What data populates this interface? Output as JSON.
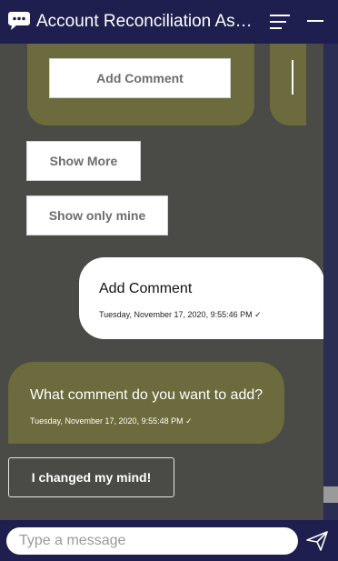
{
  "header": {
    "title": "Account Reconciliation Ass...",
    "logo_icon": "chat-bubble-icon",
    "menu_icon": "hamburger-menu-icon",
    "minimize_icon": "minimize-icon"
  },
  "chat": {
    "card_button_label": "Add Comment",
    "show_more_label": "Show More",
    "show_only_mine_label": "Show only mine",
    "user_message": {
      "text": "Add Comment",
      "timestamp": "Tuesday, November 17, 2020, 9:55:46 PM ✓"
    },
    "bot_message": {
      "text": "What comment do you want to add?",
      "timestamp": "Tuesday, November 17, 2020, 9:55:48 PM ✓"
    },
    "action_button_label": "I changed my mind!"
  },
  "footer": {
    "input_placeholder": "Type a message",
    "input_value": "",
    "send_icon": "send-icon"
  },
  "colors": {
    "header_bg": "#1e1f4e",
    "chat_bg": "#4a4a46",
    "accent_olive": "#6b6b3d",
    "bubble_user": "#ffffff"
  }
}
